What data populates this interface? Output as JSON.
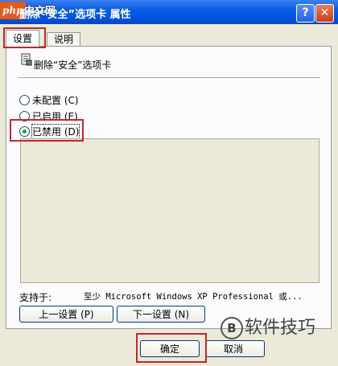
{
  "window": {
    "title": "删除“安全”选项卡 属性",
    "logo_text": "php",
    "logo_cn": "中文网",
    "help_label": "?",
    "close_label": "✕"
  },
  "tabs": [
    {
      "label": "设置",
      "active": true
    },
    {
      "label": "说明",
      "active": false
    }
  ],
  "policy": {
    "name": "删除“安全”选项卡",
    "icon": "policy-setting-icon"
  },
  "options": [
    {
      "label": "未配置 (C)",
      "selected": false
    },
    {
      "label": "已启用 (E)",
      "selected": false
    },
    {
      "label": "已禁用 (D)",
      "selected": true
    }
  ],
  "support": {
    "label": "支持于:",
    "value": "至少 Microsoft Windows XP Professional 或..."
  },
  "buttons": {
    "prev": "上一设置 (P)",
    "next": "下一设置 (N)",
    "ok": "确定",
    "cancel": "取消"
  },
  "watermark": {
    "text": "软件技巧",
    "badge": "B"
  },
  "colors": {
    "titlebar": "#0054e3",
    "highlight_box": "#c0282d",
    "dialog_bg": "#ece9d8"
  }
}
